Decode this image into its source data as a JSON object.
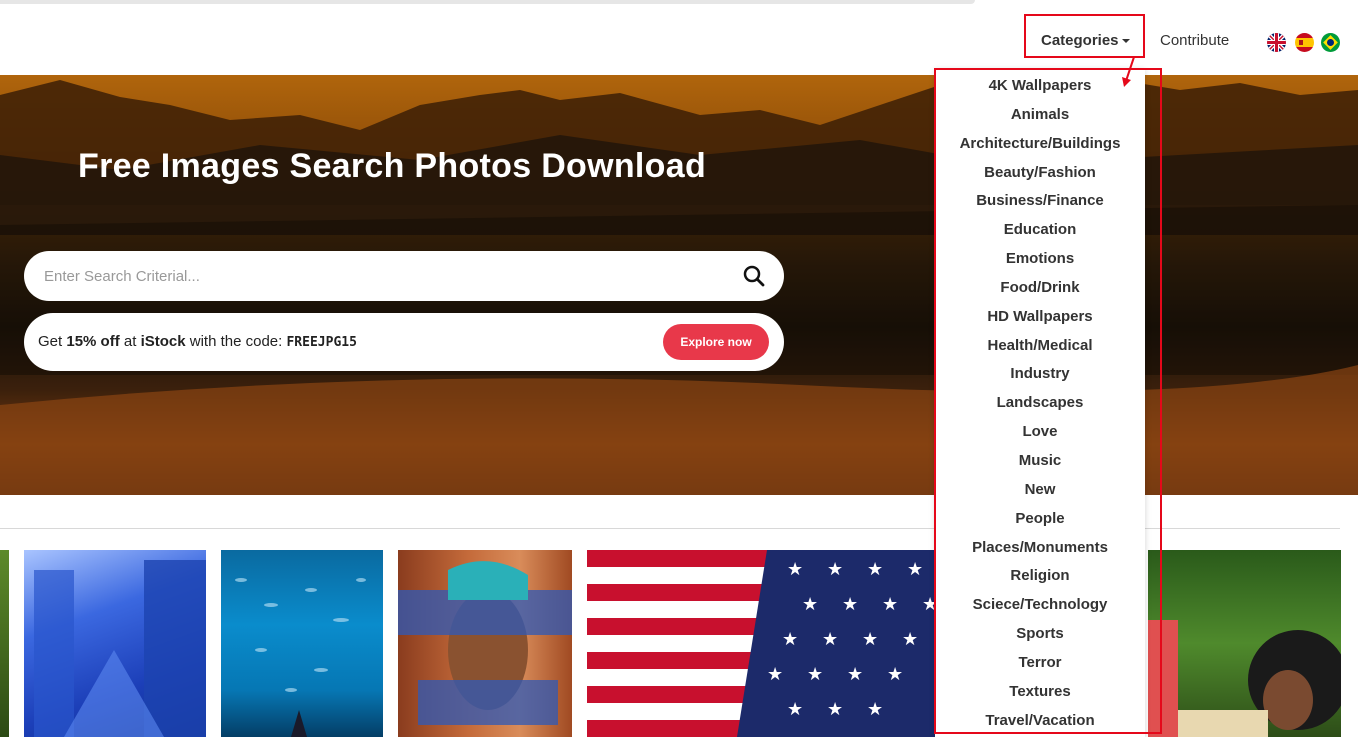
{
  "nav": {
    "categories_label": "Categories",
    "contribute_label": "Contribute",
    "flags": [
      "uk-flag-icon",
      "spain-flag-icon",
      "brazil-flag-icon"
    ]
  },
  "hero": {
    "title": "Free Images Search Photos Download"
  },
  "search": {
    "placeholder": "Enter Search Criterial..."
  },
  "promo": {
    "prefix": "Get ",
    "discount": "15% off",
    "middle": " at ",
    "brand": "iStock",
    "suffix": " with the code: ",
    "code": "FREEJPG15",
    "button_label": "Explore now",
    "button_color": "#e8384a"
  },
  "categories_menu": {
    "items": [
      "4K Wallpapers",
      "Animals",
      "Architecture/Buildings",
      "Beauty/Fashion",
      "Business/Finance",
      "Education",
      "Emotions",
      "Food/Drink",
      "HD Wallpapers",
      "Health/Medical",
      "Industry",
      "Landscapes",
      "Love",
      "Music",
      "New",
      "People",
      "Places/Monuments",
      "Religion",
      "Sciece/Technology",
      "Sports",
      "Terror",
      "Textures",
      "Travel/Vacation"
    ]
  },
  "colors": {
    "highlight": "#e5081a"
  }
}
